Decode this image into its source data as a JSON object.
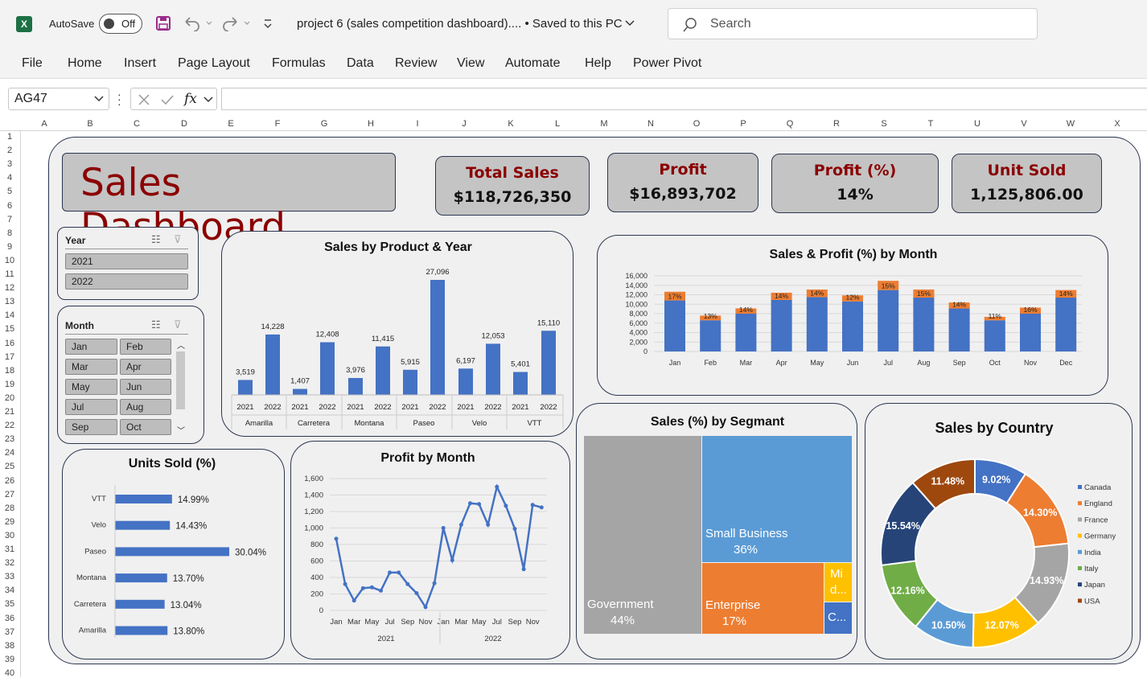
{
  "titlebar": {
    "autosave_label": "AutoSave",
    "autosave_state": "Off",
    "filename": "project 6 (sales competition dashboard).... • Saved to this PC",
    "search_placeholder": "Search"
  },
  "menu": [
    "File",
    "Home",
    "Insert",
    "Page Layout",
    "Formulas",
    "Data",
    "Review",
    "View",
    "Automate",
    "Help",
    "Power Pivot"
  ],
  "formula": {
    "name_box": "AG47",
    "fx": "fx",
    "value": ""
  },
  "columns": [
    "A",
    "B",
    "C",
    "D",
    "E",
    "F",
    "G",
    "H",
    "I",
    "J",
    "K",
    "L",
    "M",
    "N",
    "O",
    "P",
    "Q",
    "R",
    "S",
    "T",
    "U",
    "V",
    "W",
    "X"
  ],
  "rows": [
    "1",
    "2",
    "3",
    "4",
    "5",
    "6",
    "7",
    "8",
    "9",
    "10",
    "11",
    "12",
    "13",
    "14",
    "15",
    "16",
    "17",
    "18",
    "19",
    "20",
    "21",
    "22",
    "23",
    "24",
    "25",
    "26",
    "27",
    "28",
    "29",
    "30",
    "31",
    "32",
    "33",
    "34",
    "35",
    "36",
    "37",
    "38",
    "39",
    "40"
  ],
  "dashboard": {
    "title": "Sales Dashboard",
    "kpis": [
      {
        "label": "Total Sales",
        "value": "$118,726,350"
      },
      {
        "label": "Profit",
        "value": "$16,893,702"
      },
      {
        "label": "Profit (%)",
        "value": "14%"
      },
      {
        "label": "Unit Sold",
        "value": "1,125,806.00"
      }
    ],
    "year_slicer": {
      "header": "Year",
      "items": [
        "2021",
        "2022"
      ]
    },
    "month_slicer": {
      "header": "Month",
      "items": [
        "Jan",
        "Feb",
        "Mar",
        "Apr",
        "May",
        "Jun",
        "Jul",
        "Aug",
        "Sep",
        "Oct"
      ]
    },
    "colors": {
      "blue": "#4472c4",
      "orange": "#ed7d31",
      "gray": "#a5a5a5",
      "title_red": "#8b0000",
      "border": "#2c3750"
    }
  },
  "chart_data": [
    {
      "type": "bar",
      "title": "Sales by Product & Year",
      "groups": [
        "Amarilla",
        "Carretera",
        "Montana",
        "Paseo",
        "Velo",
        "VTT"
      ],
      "categories": [
        "2021",
        "2022",
        "2021",
        "2022",
        "2021",
        "2022",
        "2021",
        "2022",
        "2021",
        "2022",
        "2021",
        "2022"
      ],
      "values": [
        3519,
        14228,
        1407,
        12408,
        3976,
        11415,
        5915,
        27096,
        6197,
        12053,
        5401,
        15110
      ],
      "labels": [
        "3,519",
        "14,228",
        "1,407",
        "12,408",
        "3,976",
        "11,415",
        "5,915",
        "27,096",
        "6,197",
        "12,053",
        "5,401",
        "15,110"
      ]
    },
    {
      "type": "bar",
      "title": "Sales & Profit (%) by Month",
      "categories": [
        "Jan",
        "Feb",
        "Mar",
        "Apr",
        "May",
        "Jun",
        "Jul",
        "Aug",
        "Sep",
        "Oct",
        "Nov",
        "Dec"
      ],
      "series": [
        {
          "values": [
            10800,
            6600,
            8000,
            10900,
            11500,
            10600,
            13000,
            11400,
            9100,
            6600,
            8000,
            11400
          ]
        },
        {
          "values": [
            1840,
            990,
            1120,
            1530,
            1610,
            1270,
            1950,
            1710,
            1270,
            730,
            1280,
            1600
          ]
        }
      ],
      "bar_labels": [
        "17%",
        "13%",
        "14%",
        "14%",
        "14%",
        "12%",
        "15%",
        "15%",
        "14%",
        "11%",
        "16%",
        "14%"
      ],
      "yticks": [
        "16,000",
        "14,000",
        "12,000",
        "10,000",
        "8,000",
        "6,000",
        "4,000",
        "2,000",
        "0"
      ],
      "ylim": [
        0,
        16000
      ]
    },
    {
      "type": "bar",
      "title": "Units Sold (%)",
      "categories": [
        "VTT",
        "Velo",
        "Paseo",
        "Montana",
        "Carretera",
        "Amarilla"
      ],
      "values": [
        14.99,
        14.43,
        30.04,
        13.7,
        13.04,
        13.8
      ],
      "labels": [
        "14.99%",
        "14.43%",
        "30.04%",
        "13.70%",
        "13.04%",
        "13.80%"
      ]
    },
    {
      "type": "line",
      "title": "Profit by Month",
      "x_labels": [
        "Jan",
        "Mar",
        "May",
        "Jul",
        "Sep",
        "Nov",
        "Jan",
        "Mar",
        "May",
        "Jul",
        "Sep",
        "Nov"
      ],
      "x_groups": [
        "2021",
        "2022"
      ],
      "values": [
        870,
        320,
        120,
        270,
        280,
        240,
        460,
        460,
        320,
        210,
        40,
        330,
        1000,
        610,
        1040,
        1300,
        1290,
        1040,
        1500,
        1270,
        990,
        500,
        1280,
        1250
      ],
      "yticks": [
        "1,600",
        "1,400",
        "1,200",
        "1,000",
        "800",
        "600",
        "400",
        "200",
        "0"
      ],
      "ylim": [
        0,
        1600
      ]
    },
    {
      "type": "treemap",
      "title": "Sales (%) by Segmant",
      "items": [
        {
          "name": "Government",
          "value": "44%"
        },
        {
          "name": "Small Business",
          "value": "36%"
        },
        {
          "name": "Enterprise",
          "value": "17%"
        },
        {
          "name": "Mi d...",
          "value": ""
        },
        {
          "name": "C...",
          "value": ""
        }
      ]
    },
    {
      "type": "pie",
      "title": "Sales by Country",
      "legend": [
        "Canada",
        "England",
        "France",
        "Germany",
        "India",
        "Italy",
        "Japan",
        "USA"
      ],
      "values": [
        9.02,
        14.3,
        14.93,
        12.07,
        10.5,
        12.16,
        15.54,
        11.48
      ],
      "labels": [
        "9.02%",
        "14.30%",
        "14.93%",
        "12.07%",
        "10.50%",
        "12.16%",
        "15.54%",
        "11.48%"
      ],
      "colors": [
        "#4472c4",
        "#ed7d31",
        "#a5a5a5",
        "#ffc000",
        "#5b9bd5",
        "#70ad47",
        "#264478",
        "#9e480e"
      ],
      "legend_position": "right"
    }
  ]
}
